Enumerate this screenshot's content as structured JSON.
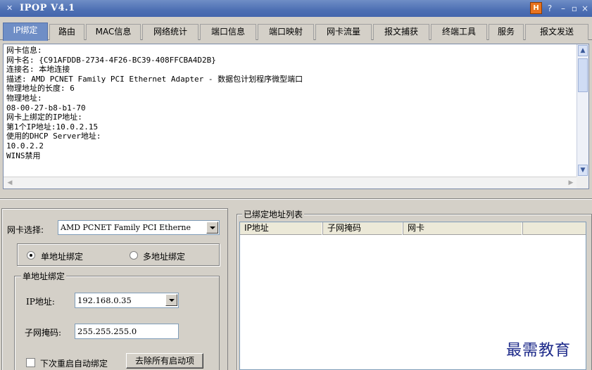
{
  "window": {
    "title": "IPOP V4.1",
    "controls": {
      "app": "H",
      "help": "?",
      "minimize": "–",
      "maximize": "▫",
      "close": "×"
    }
  },
  "tabs": [
    {
      "label": "IP绑定",
      "active": true
    },
    {
      "label": "路由"
    },
    {
      "label": "MAC信息"
    },
    {
      "label": "网络统计"
    },
    {
      "label": "端口信息"
    },
    {
      "label": "端口映射"
    },
    {
      "label": "网卡流量"
    },
    {
      "label": "报文捕获"
    },
    {
      "label": "终端工具"
    },
    {
      "label": "服务"
    },
    {
      "label": "报文发送"
    }
  ],
  "info": {
    "lines": [
      "网卡信息:",
      "网卡名: {C91AFDDB-2734-4F26-BC39-408FFCBA4D2B}",
      "连接名: 本地连接",
      "描述: AMD PCNET Family PCI Ethernet Adapter - 数据包计划程序微型端口",
      "物理地址的长度: 6",
      "物理地址:",
      "08-00-27-b8-b1-70",
      "网卡上绑定的IP地址:",
      "第1个IP地址:10.0.2.15",
      "使用的DHCP Server地址:",
      "10.0.2.2",
      "WINS禁用"
    ]
  },
  "binding": {
    "nic_label": "网卡选择:",
    "nic_value": "AMD PCNET Family PCI Etherne",
    "mode_single": "单地址绑定",
    "mode_multi": "多地址绑定",
    "single_group_title": "单地址绑定",
    "ip_label": "IP地址:",
    "ip_value": "192.168.0.35",
    "mask_label": "子网掩码:",
    "mask_value": "255.255.255.0",
    "autobind_label": "下次重启自动绑定",
    "clear_button": "去除所有启动项"
  },
  "bound_list": {
    "title": "已绑定地址列表",
    "columns": [
      "IP地址",
      "子网掩码",
      "网卡"
    ]
  },
  "watermark": "最需教育",
  "colors": {
    "titlebar": "#4d6fb3",
    "active_tab": "#6f8ec6",
    "face": "#d4d0c8"
  }
}
